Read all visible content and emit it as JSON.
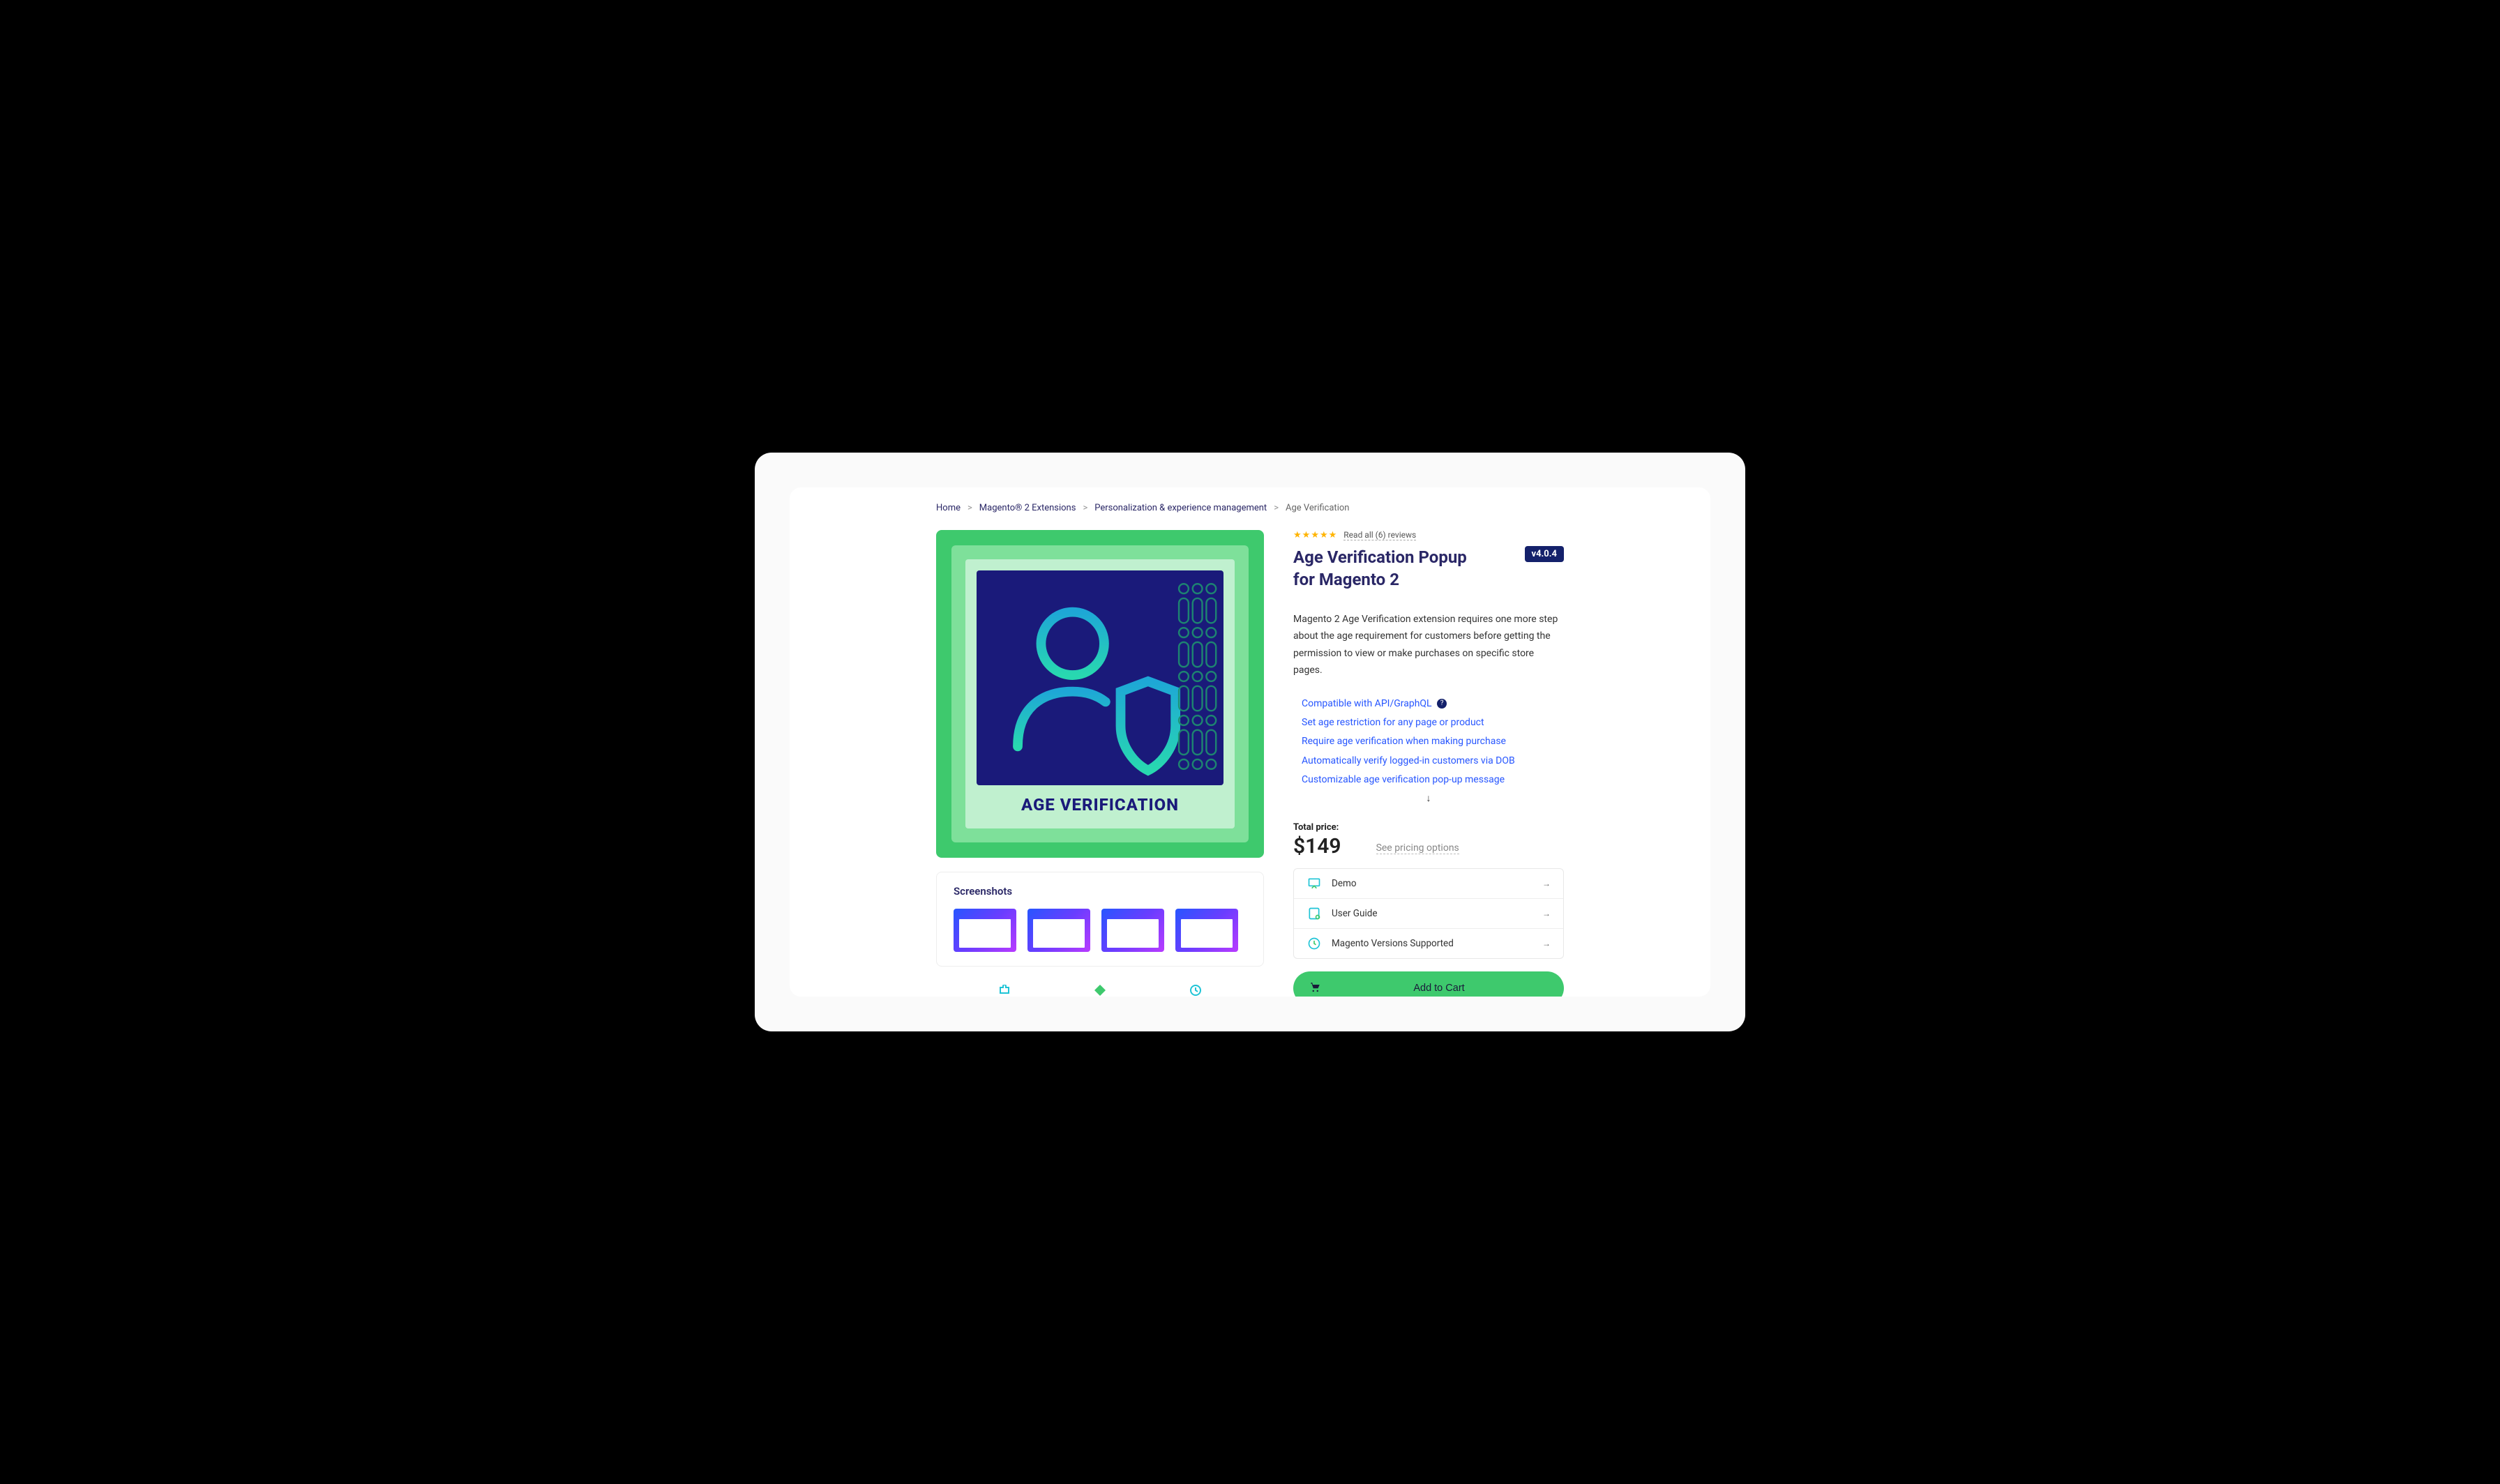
{
  "breadcrumb": {
    "home": "Home",
    "ext": "Magento® 2 Extensions",
    "cat": "Personalization & experience management",
    "current": "Age Verification"
  },
  "hero": {
    "label": "AGE VERIFICATION"
  },
  "screenshots": {
    "title": "Screenshots"
  },
  "product": {
    "reviews_link": "Read all (6) reviews",
    "title": "Age Verification Popup for Magento 2",
    "version": "v4.0.4",
    "description": "Magento 2 Age Verification extension requires one more step about the age requirement for customers before getting the permission to view or make purchases on specific store pages.",
    "features": [
      "Compatible with API/GraphQL",
      "Set age restriction for any page or product",
      "Require age verification when making purchase",
      "Automatically verify logged-in customers via DOB",
      "Customizable age verification pop-up message"
    ]
  },
  "pricing": {
    "label": "Total price:",
    "value": "$149",
    "options_link": "See pricing options"
  },
  "info_items": {
    "demo": "Demo",
    "guide": "User Guide",
    "versions": "Magento Versions Supported"
  },
  "cart": {
    "label": "Add to Cart"
  }
}
